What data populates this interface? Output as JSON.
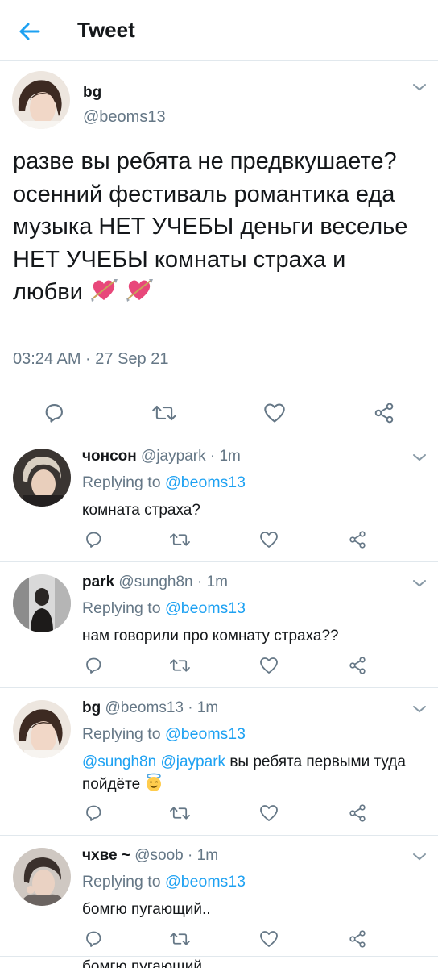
{
  "header": {
    "title": "Tweet",
    "back_icon": "arrow-left-icon"
  },
  "colors": {
    "accent": "#1da1f2",
    "secondary": "#657786",
    "text": "#14171a",
    "divider": "#e1e8ed"
  },
  "main_tweet": {
    "name": "bg",
    "handle": "@beoms13",
    "text": "разве вы ребята не предвкушаете? осенний фестиваль романтика еда музыка НЕТ УЧЕБЫ деньги веселье НЕТ УЧЕБЫ комнаты страха и любви",
    "emojis": [
      "heart-with-arrow",
      "heart-with-arrow"
    ],
    "timestamp": "03:24 AM · 27 Sep 21"
  },
  "replies": [
    {
      "name": "чонсон",
      "handle": "@jaypark",
      "time": "· 1m",
      "replying_label": "Replying to",
      "replying_to": "@beoms13",
      "text": "комната страха?"
    },
    {
      "name": "park",
      "handle": "@sungh8n",
      "time": "· 1m",
      "replying_label": "Replying to",
      "replying_to": "@beoms13",
      "text": "нам говорили про комнату страха??"
    },
    {
      "name": "bg",
      "handle": "@beoms13",
      "time": "· 1m",
      "replying_label": "Replying to",
      "replying_to": "@beoms13",
      "mentions": [
        "@sungh8n",
        "@jaypark"
      ],
      "text": "вы ребята первыми туда пойдёте",
      "emoji": "smiling-face-with-halo"
    },
    {
      "name": "чхве ~",
      "handle": "@soob",
      "time": "· 1m",
      "replying_label": "Replying to",
      "replying_to": "@beoms13",
      "text": "бомгю пугающий.."
    }
  ],
  "partial_next_text": "бомгю пугающий..",
  "actions": [
    "reply-icon",
    "retweet-icon",
    "like-icon",
    "share-icon"
  ]
}
